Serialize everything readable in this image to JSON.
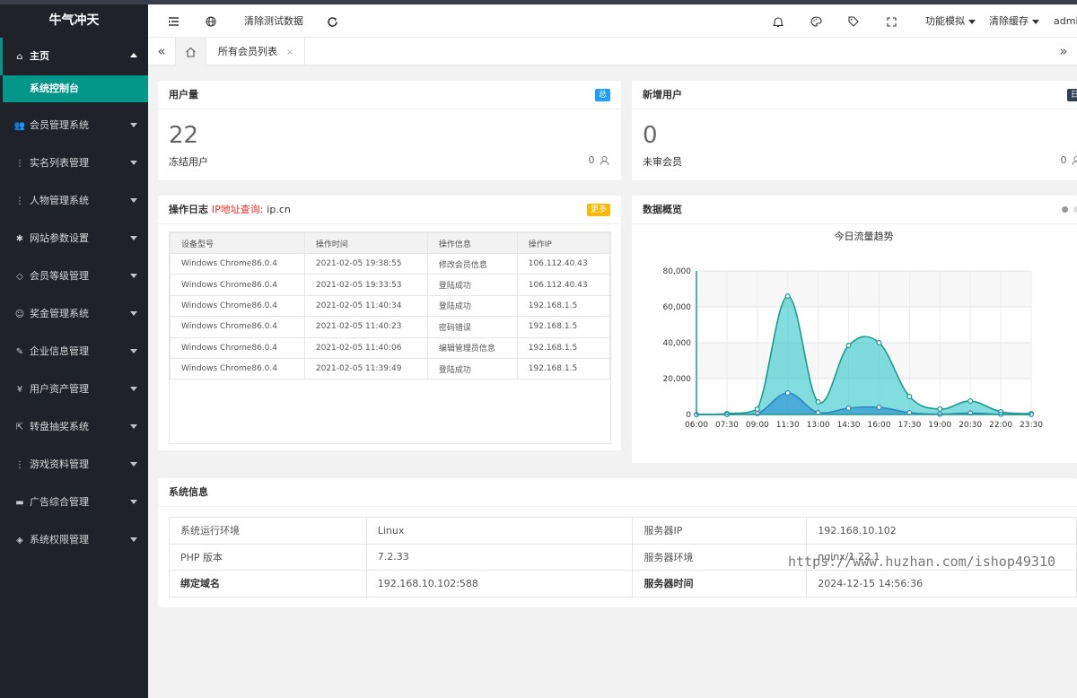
{
  "app": {
    "title": "牛气冲天"
  },
  "sidebar": {
    "home": {
      "label": "主页",
      "sub": "系统控制台"
    },
    "items": [
      {
        "label": "会员管理系统",
        "icon": "users-icon"
      },
      {
        "label": "实名列表管理",
        "icon": "dots-icon"
      },
      {
        "label": "人物管理系统",
        "icon": "dots-icon"
      },
      {
        "label": "网站参数设置",
        "icon": "gear-icon"
      },
      {
        "label": "会员等级管理",
        "icon": "diamond-icon"
      },
      {
        "label": "奖金管理系统",
        "icon": "smile-icon"
      },
      {
        "label": "企业信息管理",
        "icon": "edit-icon"
      },
      {
        "label": "用户资产管理",
        "icon": "yen-icon"
      },
      {
        "label": "转盘抽奖系统",
        "icon": "share-icon"
      },
      {
        "label": "游戏资料管理",
        "icon": "dots-icon"
      },
      {
        "label": "广告综合管理",
        "icon": "chat-icon"
      },
      {
        "label": "系统权限管理",
        "icon": "shield-icon"
      }
    ]
  },
  "header": {
    "clear_test_data": "清除测试数据",
    "feature_sim": "功能模拟",
    "clear_cache": "清除缓存",
    "user": "admin"
  },
  "tabs": {
    "current": "所有会员列表",
    "close": "×"
  },
  "cards": {
    "users": {
      "title": "用户量",
      "badge": "总",
      "value": "22",
      "sub_label": "冻结用户",
      "sub_value": "0"
    },
    "new_users": {
      "title": "新增用户",
      "badge": "日",
      "value": "0",
      "sub_label": "未审会员",
      "sub_value": "0"
    }
  },
  "log": {
    "title": "操作日志",
    "ip_label": "IP地址查询:",
    "ip_site": "ip.cn",
    "more": "更多",
    "columns": [
      "设备型号",
      "操作时间",
      "操作信息",
      "操作IP"
    ],
    "rows": [
      [
        "Windows Chrome86.0.4",
        "2021-02-05 19:38:55",
        "修改会员信息",
        "106.112.40.43"
      ],
      [
        "Windows Chrome86.0.4",
        "2021-02-05 19:33:53",
        "登陆成功",
        "106.112.40.43"
      ],
      [
        "Windows Chrome86.0.4",
        "2021-02-05 11:40:34",
        "登陆成功",
        "192.168.1.5"
      ],
      [
        "Windows Chrome86.0.4",
        "2021-02-05 11:40:23",
        "密码错误",
        "192.168.1.5"
      ],
      [
        "Windows Chrome86.0.4",
        "2021-02-05 11:40:06",
        "编辑管理员信息",
        "192.168.1.5"
      ],
      [
        "Windows Chrome86.0.4",
        "2021-02-05 11:39:49",
        "登陆成功",
        "192.168.1.5"
      ]
    ]
  },
  "overview": {
    "title": "数据概览",
    "chart_data": {
      "type": "area",
      "title": "今日流量趋势",
      "x": [
        "06:00",
        "07:30",
        "09:00",
        "11:30",
        "13:00",
        "14:30",
        "16:00",
        "17:30",
        "19:00",
        "20:30",
        "22:00",
        "23:30"
      ],
      "ylim": [
        0,
        80000
      ],
      "yticks": [
        "0",
        "20,000",
        "40,000",
        "60,000",
        "80,000"
      ],
      "grid": true,
      "series": [
        {
          "values": [
            0,
            500,
            3000,
            66000,
            7000,
            38500,
            40000,
            10000,
            3000,
            7500,
            1500,
            500
          ],
          "color": "#2ec7c9"
        },
        {
          "values": [
            0,
            0,
            500,
            12000,
            1000,
            3500,
            4000,
            1000,
            200,
            800,
            100,
            0
          ],
          "color": "#3a9bd5"
        }
      ]
    }
  },
  "sysinfo": {
    "title": "系统信息",
    "rows": [
      [
        "系统运行环境",
        "Linux",
        "服务器IP",
        "192.168.10.102"
      ],
      [
        "PHP 版本",
        "7.2.33",
        "服务器环境",
        "nginx/1.22.1"
      ],
      [
        "绑定域名",
        "192.168.10.102:588",
        "服务器时间",
        "2024-12-15 14:56:36"
      ]
    ]
  },
  "watermark": "https://www.huzhan.com/ishop49310",
  "colors": {
    "accent": "#009688",
    "sidebar": "#20222a",
    "badge_blue": "#1e9fff",
    "badge_dark": "#2f4056",
    "badge_orange": "#ffb800"
  }
}
